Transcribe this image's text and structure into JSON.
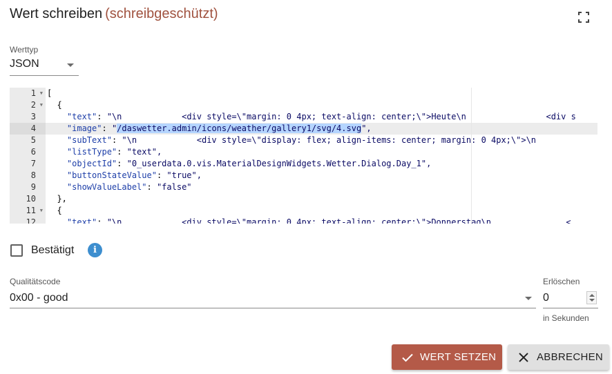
{
  "header": {
    "title": "Wert schreiben",
    "readonly_note": "(schreibgeschützt)",
    "fullscreen_icon": "fullscreen-icon"
  },
  "value_type": {
    "label": "Werttyp",
    "selected": "JSON"
  },
  "editor": {
    "lines": [
      {
        "n": "1",
        "fold": true,
        "active": false
      },
      {
        "n": "2",
        "fold": true,
        "active": false
      },
      {
        "n": "3",
        "fold": false,
        "active": false
      },
      {
        "n": "4",
        "fold": false,
        "active": true
      },
      {
        "n": "5",
        "fold": false,
        "active": false
      },
      {
        "n": "6",
        "fold": false,
        "active": false
      },
      {
        "n": "7",
        "fold": false,
        "active": false
      },
      {
        "n": "8",
        "fold": false,
        "active": false
      },
      {
        "n": "9",
        "fold": false,
        "active": false
      },
      {
        "n": "10",
        "fold": false,
        "active": false
      },
      {
        "n": "11",
        "fold": true,
        "active": false
      },
      {
        "n": "12",
        "fold": false,
        "active": false
      }
    ],
    "code": {
      "l1": "[",
      "l2": "  {",
      "l3_key": "\"text\"",
      "l3_val": "\"\\n            <div style=\\\"margin: 0 4px; text-align: center;\\\">Heute\\n                <div s",
      "l4_key": "\"image\"",
      "l4_q": "\"",
      "l4_sel": "/daswetter.admin/icons/weather/gallery1/svg/4.svg",
      "l4_end": "\",",
      "l5_key": "\"subText\"",
      "l5_val": "\"\\n            <div style=\\\"display: flex; align-items: center; margin: 0 4px;\\\">\\n",
      "l6_key": "\"listType\"",
      "l6_val": "\"text\",",
      "l7_key": "\"objectId\"",
      "l7_val": "\"0_userdata.0.vis.MaterialDesignWidgets.Wetter.Dialog.Day_1\",",
      "l8_key": "\"buttonStateValue\"",
      "l8_val": "\"true\",",
      "l9_key": "\"showValueLabel\"",
      "l9_val": "\"false\"",
      "l10": "  },",
      "l11": "  {",
      "l12_key": "\"text\"",
      "l12_val": "\"\\n            <div style=\\\"margin: 0 4px; text-align: center;\\\">Donnerstag\\n               <"
    }
  },
  "confirmed": {
    "label": "Bestätigt",
    "checked": false,
    "info_icon": "info-icon",
    "info_glyph": "i"
  },
  "quality": {
    "label": "Qualitätscode",
    "selected": "0x00 - good"
  },
  "expire": {
    "label": "Erlöschen",
    "value": "0",
    "hint": "in Sekunden"
  },
  "buttons": {
    "set_label": "WERT SETZEN",
    "cancel_label": "ABBRECHEN"
  },
  "colors": {
    "primary": "#b45a48",
    "readonly_text": "#a0523f",
    "info": "#3d8ecf",
    "selection": "#b5d5ff"
  }
}
